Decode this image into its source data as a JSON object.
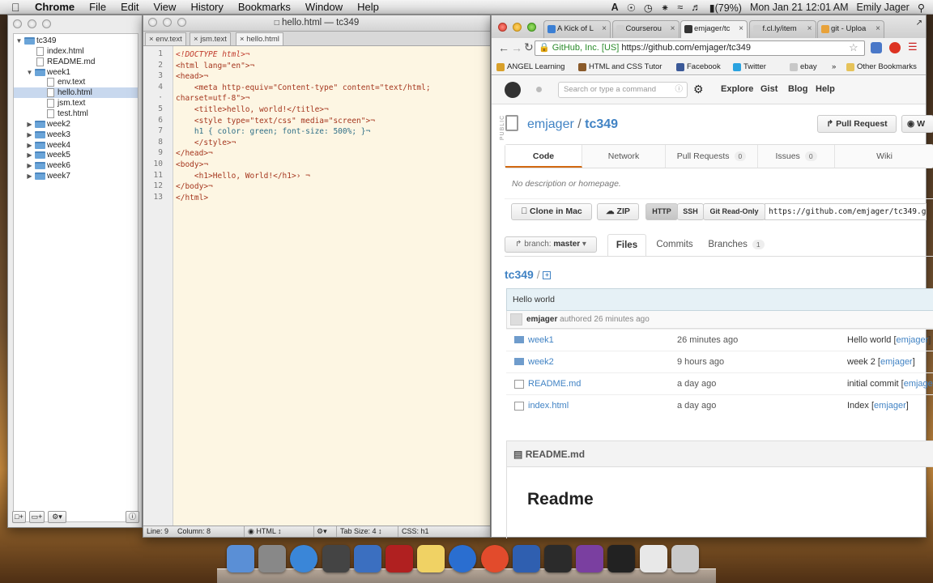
{
  "menubar": {
    "app": "Chrome",
    "menus": [
      "File",
      "Edit",
      "View",
      "History",
      "Bookmarks",
      "Window",
      "Help"
    ],
    "battery": "(79%)",
    "clock": "Mon Jan 21  12:01 AM",
    "user": "Emily Jager"
  },
  "drawer": {
    "tree": [
      {
        "label": "tc349",
        "type": "folder",
        "open": true,
        "depth": 0
      },
      {
        "label": "index.html",
        "type": "file",
        "depth": 1
      },
      {
        "label": "README.md",
        "type": "file",
        "depth": 1
      },
      {
        "label": "week1",
        "type": "folder",
        "open": true,
        "depth": 1
      },
      {
        "label": "env.text",
        "type": "file",
        "depth": 2
      },
      {
        "label": "hello.html",
        "type": "file",
        "depth": 2,
        "selected": true
      },
      {
        "label": "jsm.text",
        "type": "file",
        "depth": 2
      },
      {
        "label": "test.html",
        "type": "file",
        "depth": 2
      },
      {
        "label": "week2",
        "type": "folder",
        "open": false,
        "depth": 1
      },
      {
        "label": "week3",
        "type": "folder",
        "open": false,
        "depth": 1
      },
      {
        "label": "week4",
        "type": "folder",
        "open": false,
        "depth": 1
      },
      {
        "label": "week5",
        "type": "folder",
        "open": false,
        "depth": 1
      },
      {
        "label": "week6",
        "type": "folder",
        "open": false,
        "depth": 1
      },
      {
        "label": "week7",
        "type": "folder",
        "open": false,
        "depth": 1
      }
    ]
  },
  "editor": {
    "title": "hello.html — tc349",
    "tabs": [
      "env.text",
      "jsm.text",
      "hello.html"
    ],
    "line_numbers": [
      "1",
      "2",
      "3",
      "4",
      "·",
      "5",
      "6",
      "7",
      "8",
      "9",
      "10",
      "11",
      "12",
      "13"
    ],
    "lines": [
      "<!DOCTYPE html>¬",
      "<html lang=\"en\">¬",
      "<head>¬",
      "    <meta http-equiv=\"Content-type\" content=\"text/html;",
      "charset=utf-8\">¬",
      "    <title>hello, world!</title>¬",
      "    <style type=\"text/css\" media=\"screen\">¬",
      "    h1 { color: green; font-size: 500%; }¬",
      "    </style>¬",
      "</head>¬",
      "<body>¬",
      "    <h1>Hello, World!</h1>› ¬",
      "</body>¬",
      "</html>"
    ],
    "status": {
      "line": "Line: 9",
      "column": "Column: 8",
      "language": "HTML",
      "tab_size": "Tab Size:    4",
      "symbol": "CSS: h1"
    }
  },
  "chrome": {
    "tabs": [
      {
        "label": "A Kick of L",
        "color": "#3b7fd4"
      },
      {
        "label": "Courserou",
        "color": "#cfcfcf"
      },
      {
        "label": "emjager/tc",
        "color": "#333333"
      },
      {
        "label": "f.cl.ly/item",
        "color": "#cfcfcf"
      },
      {
        "label": "git - Uploa",
        "color": "#e8a23a"
      }
    ],
    "url_cert": "GitHub, Inc. [US]",
    "url_text": "https://github.com/emjager/tc349",
    "bookmarks": [
      {
        "label": "ANGEL Learning",
        "color": "#d8a02a"
      },
      {
        "label": "HTML and CSS Tutor",
        "color": "#8a5a2a"
      },
      {
        "label": "Facebook",
        "color": "#3b5998"
      },
      {
        "label": "Twitter",
        "color": "#2aa3e0"
      },
      {
        "label": "ebay",
        "color": "#c8c8c8"
      }
    ],
    "other_bookmarks": "Other Bookmarks"
  },
  "github": {
    "search_placeholder": "Search or type a command",
    "nav": [
      "Explore",
      "Gist",
      "Blog",
      "Help"
    ],
    "public_label": "PUBLIC",
    "owner": "emjager",
    "slash": " / ",
    "repo": "tc349",
    "pull_request": "Pull Request",
    "watch": "W",
    "repo_tabs": [
      {
        "label": "Code",
        "count": ""
      },
      {
        "label": "Network",
        "count": ""
      },
      {
        "label": "Pull Requests",
        "count": "0"
      },
      {
        "label": "Issues",
        "count": "0"
      },
      {
        "label": "Wiki",
        "count": ""
      }
    ],
    "description": "No description or homepage.",
    "clone_mac": "Clone in Mac",
    "zip": "ZIP",
    "protocols": [
      "HTTP",
      "SSH",
      "Git Read-Only"
    ],
    "clone_url": "https://github.com/emjager/tc349.gi",
    "branch_label": "branch:",
    "branch": "master",
    "file_tabs": [
      {
        "label": "Files",
        "count": ""
      },
      {
        "label": "Commits",
        "count": ""
      },
      {
        "label": "Branches",
        "count": "1"
      }
    ],
    "path_repo": "tc349",
    "path_sep": "/",
    "commit_message": "Hello world",
    "commit_author": "emjager",
    "commit_meta": "authored 26 minutes ago",
    "files": [
      {
        "name": "week1",
        "type": "folder",
        "age": "26 minutes ago",
        "message": "Hello world",
        "author": "emjager"
      },
      {
        "name": "week2",
        "type": "folder",
        "age": "9 hours ago",
        "message": "week 2",
        "author": "emjager"
      },
      {
        "name": "README.md",
        "type": "file",
        "age": "a day ago",
        "message": "initial commit",
        "author": "emjage"
      },
      {
        "name": "index.html",
        "type": "file",
        "age": "a day ago",
        "message": "Index",
        "author": "emjager"
      }
    ],
    "readme_header": "README.md",
    "readme_title": "Readme"
  },
  "dock": {
    "apps": [
      "finder",
      "system-preferences",
      "safari",
      "final-cut",
      "thunderbird",
      "photo-booth",
      "stickies",
      "itunes",
      "chrome",
      "word",
      "activity-monitor",
      "aperture",
      "terminal",
      "preview",
      "trash"
    ]
  }
}
